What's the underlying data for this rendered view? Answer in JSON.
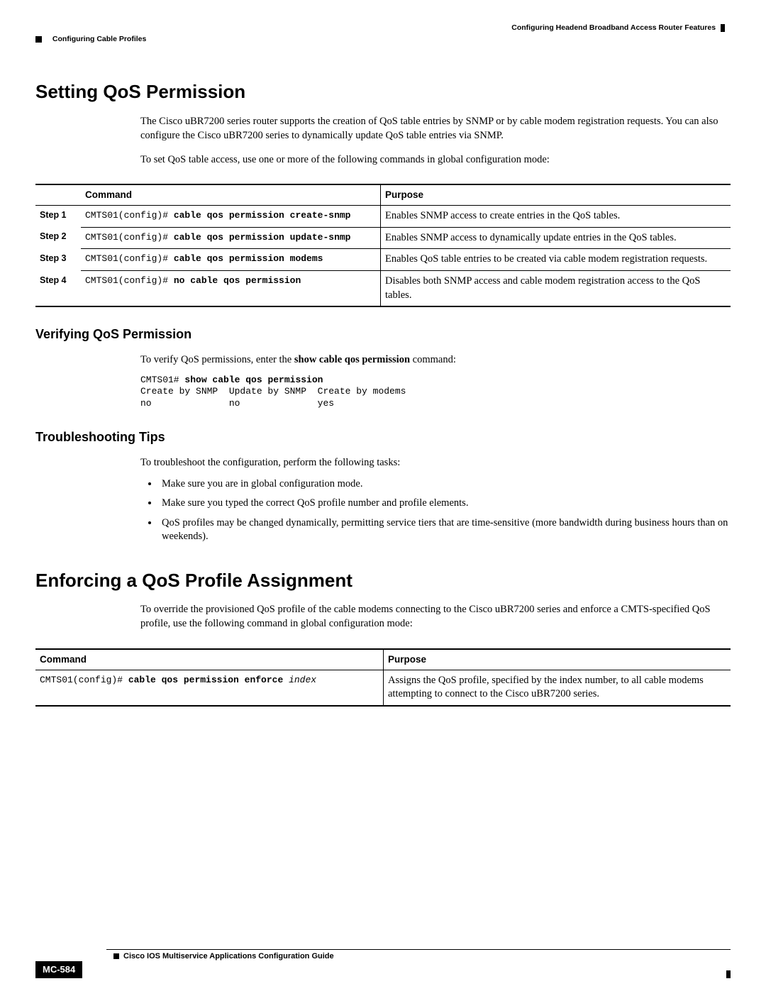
{
  "header": {
    "chapter": "Configuring Headend Broadband Access Router Features",
    "section": "Configuring Cable Profiles"
  },
  "s1": {
    "title": "Setting QoS Permission",
    "p1": "The Cisco uBR7200 series router supports the creation of QoS table entries by SNMP or by cable modem registration requests. You can also configure the Cisco uBR7200 series to dynamically update QoS table entries via SNMP.",
    "p2": "To set QoS table access, use one or more of the following commands in global configuration mode:"
  },
  "table1": {
    "head_step": "",
    "head_cmd": "Command",
    "head_purpose": "Purpose",
    "rows": [
      {
        "step": "Step 1",
        "prompt": "CMTS01(config)# ",
        "cmd": "cable qos permission create-snmp",
        "purpose": "Enables SNMP access to create entries in the QoS tables."
      },
      {
        "step": "Step 2",
        "prompt": "CMTS01(config)# ",
        "cmd": "cable qos permission update-snmp",
        "purpose": "Enables SNMP access to dynamically update entries in the QoS tables."
      },
      {
        "step": "Step 3",
        "prompt": "CMTS01(config)# ",
        "cmd": "cable qos permission modems",
        "purpose": "Enables QoS table entries to be created via cable modem registration requests."
      },
      {
        "step": "Step 4",
        "prompt": "CMTS01(config)# ",
        "cmd": "no cable qos permission",
        "purpose": "Disables both SNMP access and cable modem registration access to the QoS tables."
      }
    ]
  },
  "s2": {
    "title": "Verifying QoS Permission",
    "p1_pre": "To verify QoS permissions, enter the ",
    "p1_bold": "show cable qos permission",
    "p1_post": " command:",
    "code_prompt": "CMTS01# ",
    "code_cmd": "show cable qos permission",
    "code_line2": "Create by SNMP  Update by SNMP  Create by modems",
    "code_line3": "no              no              yes"
  },
  "s3": {
    "title": "Troubleshooting Tips",
    "p1": "To troubleshoot the configuration, perform the following tasks:",
    "items": [
      "Make sure you are in global configuration mode.",
      "Make sure you typed the correct QoS profile number and profile elements.",
      "QoS profiles may be changed dynamically, permitting service tiers that are time-sensitive (more bandwidth during business hours than on weekends)."
    ]
  },
  "s4": {
    "title": "Enforcing a QoS Profile Assignment",
    "p1": "To override the provisioned QoS profile of the cable modems connecting to the Cisco uBR7200 series and enforce a CMTS-specified QoS profile, use the following command in global configuration mode:"
  },
  "table2": {
    "head_cmd": "Command",
    "head_purpose": "Purpose",
    "prompt": "CMTS01(config)# ",
    "cmd": "cable qos permission enforce ",
    "arg": "index",
    "purpose": "Assigns the QoS profile, specified by the index number, to all cable modems attempting to connect to the Cisco uBR7200 series."
  },
  "footer": {
    "guide": "Cisco IOS Multiservice Applications Configuration Guide",
    "page": "MC-584"
  }
}
